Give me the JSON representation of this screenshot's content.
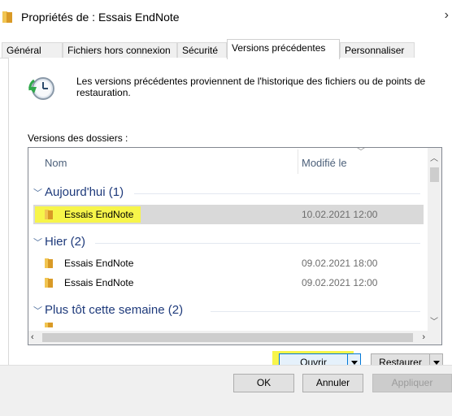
{
  "window": {
    "title": "Propriétés de : Essais EndNote",
    "close_glyph": "›"
  },
  "tabs": [
    {
      "label": "Général"
    },
    {
      "label": "Fichiers hors connexion"
    },
    {
      "label": "Sécurité"
    },
    {
      "label": "Versions précédentes"
    },
    {
      "label": "Personnaliser"
    }
  ],
  "active_tab": "Versions précédentes",
  "description": "Les versions précédentes proviennent de l'historique des fichiers ou de points de restauration.",
  "versions_label": "Versions des dossiers :",
  "columns": {
    "name": "Nom",
    "modified": "Modifié le"
  },
  "groups": [
    {
      "label": "Aujourd'hui (1)",
      "items": [
        {
          "name": "Essais EndNote",
          "modified": "10.02.2021 12:00",
          "selected": true
        }
      ]
    },
    {
      "label": "Hier (2)",
      "items": [
        {
          "name": "Essais EndNote",
          "modified": "09.02.2021 18:00"
        },
        {
          "name": "Essais EndNote",
          "modified": "09.02.2021 12:00"
        }
      ]
    },
    {
      "label": "Plus tôt cette semaine (2)",
      "items": []
    }
  ],
  "buttons": {
    "open": "Ouvrir",
    "restore": "Restaurer",
    "ok": "OK",
    "cancel": "Annuler",
    "apply": "Appliquer"
  },
  "icons": {
    "title": "folder-icon",
    "history": "history-clock-icon",
    "folder": "folder-icon"
  },
  "colors": {
    "highlight": "#f7f54a",
    "group_text": "#1e3a7b",
    "selection": "#d9d9d9",
    "folder": "#e8b84a"
  }
}
